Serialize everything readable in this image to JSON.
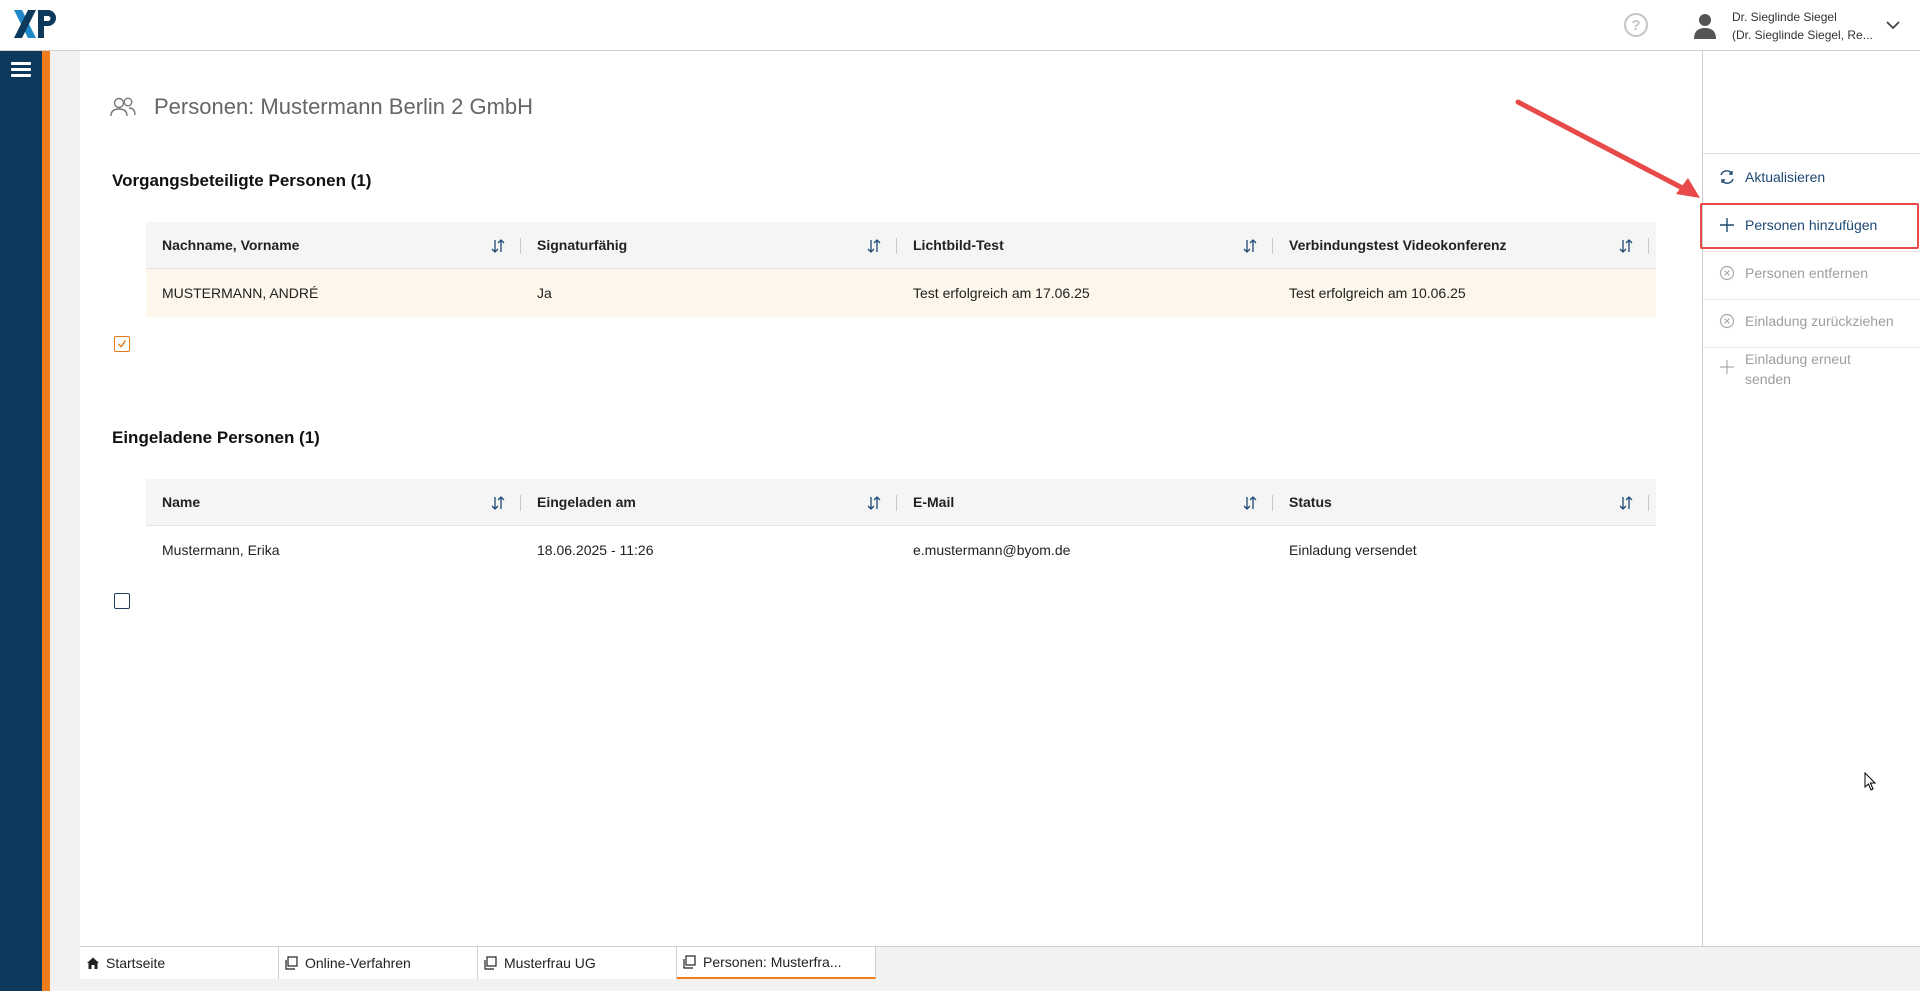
{
  "header": {
    "logo_text": "XP",
    "user": {
      "name": "Dr. Sieglinde Siegel",
      "subtitle": "(Dr. Sieglinde Siegel, Re..."
    }
  },
  "page": {
    "title": "Personen: Mustermann Berlin 2 GmbH"
  },
  "section_participants": {
    "title": "Vorgangsbeteiligte Personen (1)",
    "columns": [
      "Nachname, Vorname",
      "Signaturfähig",
      "Lichtbild-Test",
      "Verbindungstest Videokonferenz"
    ],
    "rows": [
      {
        "checked": true,
        "cells": [
          "MUSTERMANN, ANDRÉ",
          "Ja",
          "Test erfolgreich am 17.06.25",
          "Test erfolgreich am 10.06.25"
        ]
      }
    ]
  },
  "section_invited": {
    "title": "Eingeladene Personen (1)",
    "columns": [
      "Name",
      "Eingeladen am",
      "E-Mail",
      "Status"
    ],
    "rows": [
      {
        "checked": false,
        "cells": [
          "Mustermann, Erika",
          "18.06.2025 - 11:26",
          "e.mustermann@byom.de",
          "Einladung versendet"
        ]
      }
    ]
  },
  "actions": [
    {
      "label": "Aktualisieren",
      "icon": "refresh-icon",
      "enabled": true
    },
    {
      "label": "Personen hinzufügen",
      "icon": "plus-icon",
      "enabled": true,
      "highlighted": true
    },
    {
      "label": "Personen entfernen",
      "icon": "circle-x-icon",
      "enabled": false
    },
    {
      "label": "Einladung zurückziehen",
      "icon": "circle-x-icon",
      "enabled": false
    },
    {
      "label_line1": "Einladung erneut",
      "label_line2": "senden",
      "icon": "plus-icon",
      "enabled": false
    }
  ],
  "tabs": [
    {
      "label": "Startseite",
      "icon": "home-icon",
      "active": false
    },
    {
      "label": "Online-Verfahren",
      "icon": "document-icon",
      "active": false
    },
    {
      "label": "Musterfrau UG",
      "icon": "document-icon",
      "active": false
    },
    {
      "label": "Personen: Musterfra...",
      "icon": "document-icon",
      "active": true
    }
  ],
  "colors": {
    "sidebar": "#0d3a5c",
    "accent": "#f07d1a",
    "action_link": "#1d4a74",
    "highlight": "#e84a4a"
  }
}
